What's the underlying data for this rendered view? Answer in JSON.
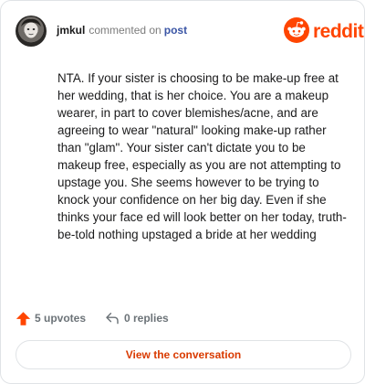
{
  "header": {
    "username": "jmkul",
    "commented_on": "commented on",
    "post_link": "post",
    "brand": "reddit"
  },
  "comment": {
    "text": "NTA. If your sister is choosing to be make-up free at her wedding, that is her choice. You are a makeup wearer, in part to cover blemishes/acne, and are agreeing to wear \"natural\" looking make-up rather than \"glam\". Your sister can't dictate you to be makeup free, especially as you are not attempting to upstage you. She seems however to be trying to knock your confidence on her big day. Even if she thinks your face ed will look better on her today, truth-be-told nothing upstaged a bride at her wedding"
  },
  "actions": {
    "upvotes": "5 upvotes",
    "replies": "0 replies",
    "view_conversation": "View the conversation"
  },
  "colors": {
    "brand": "#ff4500",
    "link": "#3a55a5",
    "button_text": "#d93a00",
    "muted": "#6c7378"
  },
  "icons": {
    "avatar": "user-avatar",
    "logo": "reddit-snoo-icon",
    "upvote": "upvote-arrow-icon",
    "reply": "reply-arrow-icon"
  }
}
